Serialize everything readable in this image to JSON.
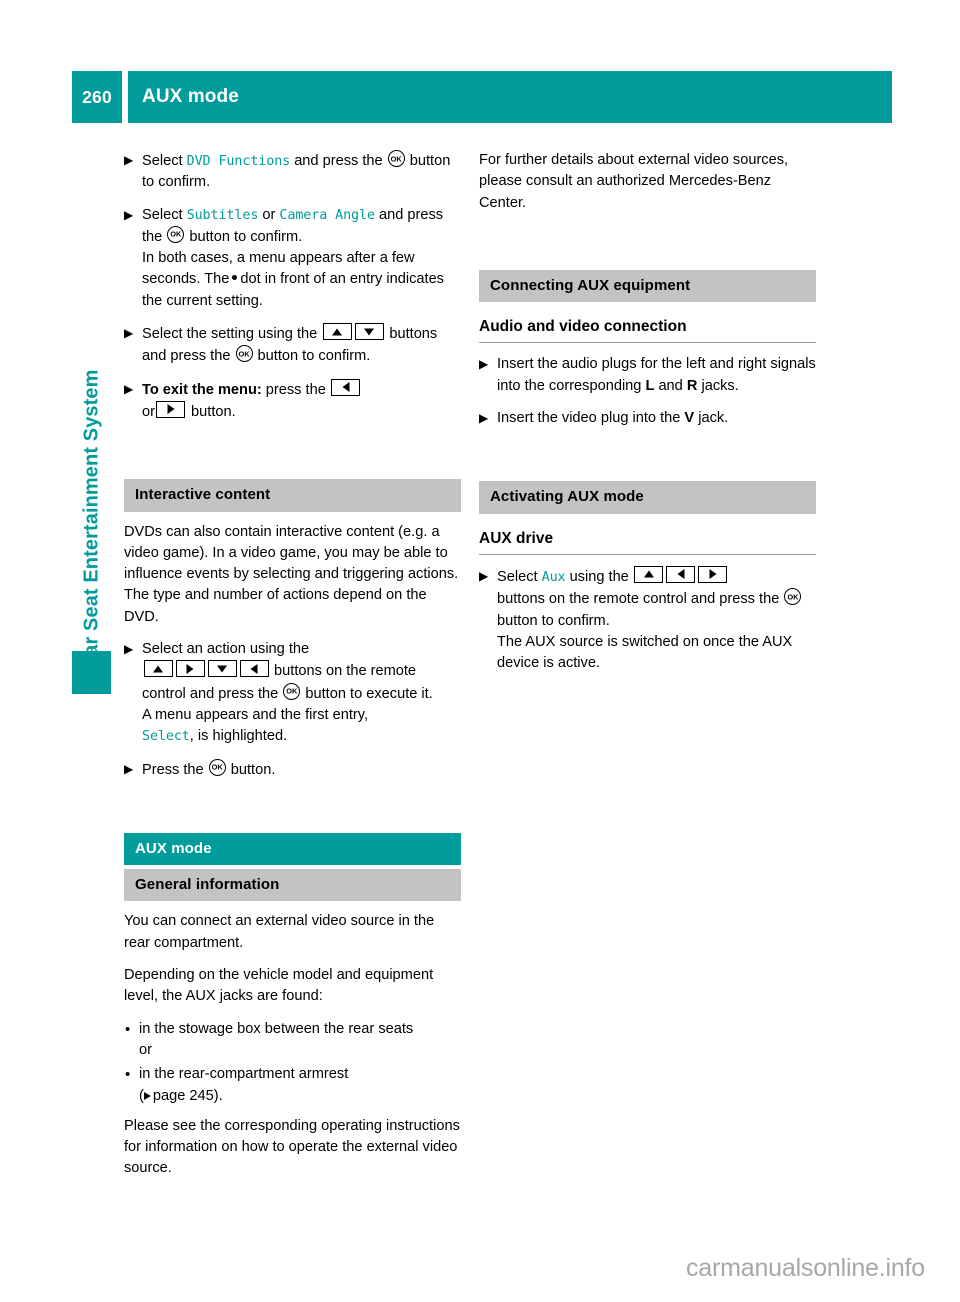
{
  "header": {
    "page_number": "260",
    "title": "AUX mode"
  },
  "sidebar": {
    "label": "Rear Seat Entertainment System"
  },
  "left_column": {
    "steps": [
      {
        "id": "step-dvd-functions",
        "text_1": "Select ",
        "menu_1": "DVD Functions",
        "text_2": " and press the ",
        "icon": "ok-button-icon",
        "text_3": " button to confirm."
      },
      {
        "id": "step-subtitles-camera-angle",
        "text_1": "Select ",
        "menu_1": "Subtitles",
        "text_2": " or ",
        "menu_2": "Camera Angle",
        "text_3": " and press the ",
        "text_4": " button to confirm.",
        "cont_1": "In both cases, a menu appears after a few seconds. The",
        "cont_2": "dot in front of an entry indicates the current setting."
      },
      {
        "id": "step-select-setting",
        "text_1": "Select the setting using the ",
        "text_2": " buttons and press the ",
        "text_3": " button to confirm."
      },
      {
        "id": "step-exit-menu",
        "bold_label": "To exit the menu:",
        "text_1": " press the ",
        "text_2": "or",
        "text_3": " button."
      }
    ],
    "interactive_content": {
      "heading": "Interactive content",
      "paragraph": "DVDs can also contain interactive content (e.g. a video game). In a video game, you may be able to influence events by selecting and triggering actions. The type and number of actions depend on the DVD.",
      "step_select_action": {
        "text_1": "Select an action using the",
        "text_2": " buttons on the remote control and press the ",
        "text_3": " button to execute it.",
        "cont_1": "A menu appears and the first entry,",
        "menu_1": "Select",
        "cont_2": ", is highlighted."
      },
      "step_press_ok": {
        "text_1": "Press the ",
        "text_2": " button."
      }
    },
    "aux_mode": {
      "heading": "AUX mode",
      "sub_heading": "General information",
      "paragraph_1": "You can connect an external video source in the rear compartment.",
      "paragraph_2": "Depending on the vehicle model and equipment level, the AUX jacks are found:",
      "bullets": [
        {
          "text": "in the stowage box between the rear seats",
          "sub": "or"
        },
        {
          "text": "in the rear-compartment armrest",
          "sub_prefix": "(",
          "sub_ref": "page 245",
          "sub_suffix": ")."
        }
      ],
      "paragraph_3": "Please see the corresponding operating instructions for information on how to operate the external video source."
    }
  },
  "right_column": {
    "intro_paragraph": "For further details about external video sources, please consult an authorized Mercedes-Benz Center.",
    "connecting_aux": {
      "heading": "Connecting AUX equipment",
      "sub_heading": "Audio and video connection",
      "step_audio": {
        "text_1": "Insert the audio plugs for the left and right signals into the corresponding ",
        "bold_1": "L",
        "text_2": " and ",
        "bold_2": "R",
        "text_3": " jacks."
      },
      "step_video": {
        "text_1": "Insert the video plug into the ",
        "bold_1": "V",
        "text_2": " jack."
      }
    },
    "activating_aux": {
      "heading": "Activating AUX mode",
      "sub_heading": "AUX drive",
      "step_select_aux": {
        "text_1": "Select ",
        "menu_1": "Aux",
        "text_2": " using the ",
        "text_3": "buttons on the remote control and press the ",
        "text_4": " button to confirm.",
        "cont_1": "The AUX source is switched on once the AUX device is active."
      }
    }
  },
  "watermark": {
    "text": "carmanualsonline.info"
  },
  "colors": {
    "teal": "#009b9b",
    "gray_bar": "#c3c3c3",
    "rule": "#9a9a9a",
    "watermark": "#a7a7a7"
  }
}
